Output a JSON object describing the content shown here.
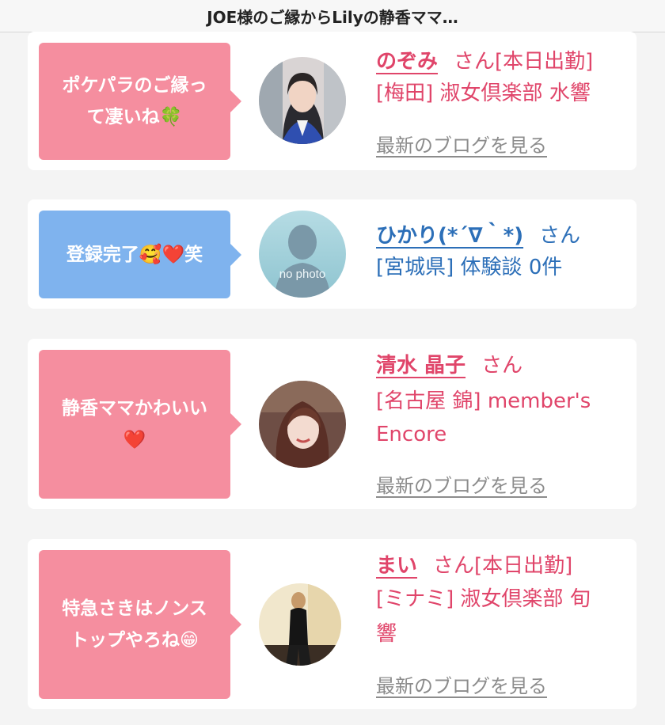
{
  "header": {
    "title": "JOE様のご縁からLilyの静香ママ…"
  },
  "cards": [
    {
      "bubble_line1": "ポケパラのご縁っ",
      "bubble_line2": "て凄いね",
      "bubble_emoji": "🍀",
      "name": "のぞみ",
      "suffix": "さん[本日出勤]",
      "detail": "[梅田] 淑女倶楽部 水響",
      "blog_link": "最新のブログを見る"
    },
    {
      "bubble_line1": "登録完了",
      "bubble_emoji": "🥰❤️",
      "bubble_after": "笑",
      "avatar_placeholder": "no photo",
      "name": "ひかり(*´∇｀*)",
      "suffix": "さん",
      "detail": "[宮城県] 体験談 0件"
    },
    {
      "bubble_line1": "静香ママかわいい",
      "bubble_emoji": "❤️",
      "name": "清水 晶子",
      "suffix": "さん",
      "detail": "[名古屋 錦] member's Encore",
      "blog_link": "最新のブログを見る"
    },
    {
      "bubble_line1": "特急さきはノンス",
      "bubble_line2": "トップやろね",
      "bubble_emoji": "😁",
      "name": "まい",
      "suffix": "さん[本日出勤]",
      "detail": "[ミナミ] 淑女倶楽部 旬響",
      "blog_link": "最新のブログを見る"
    }
  ]
}
